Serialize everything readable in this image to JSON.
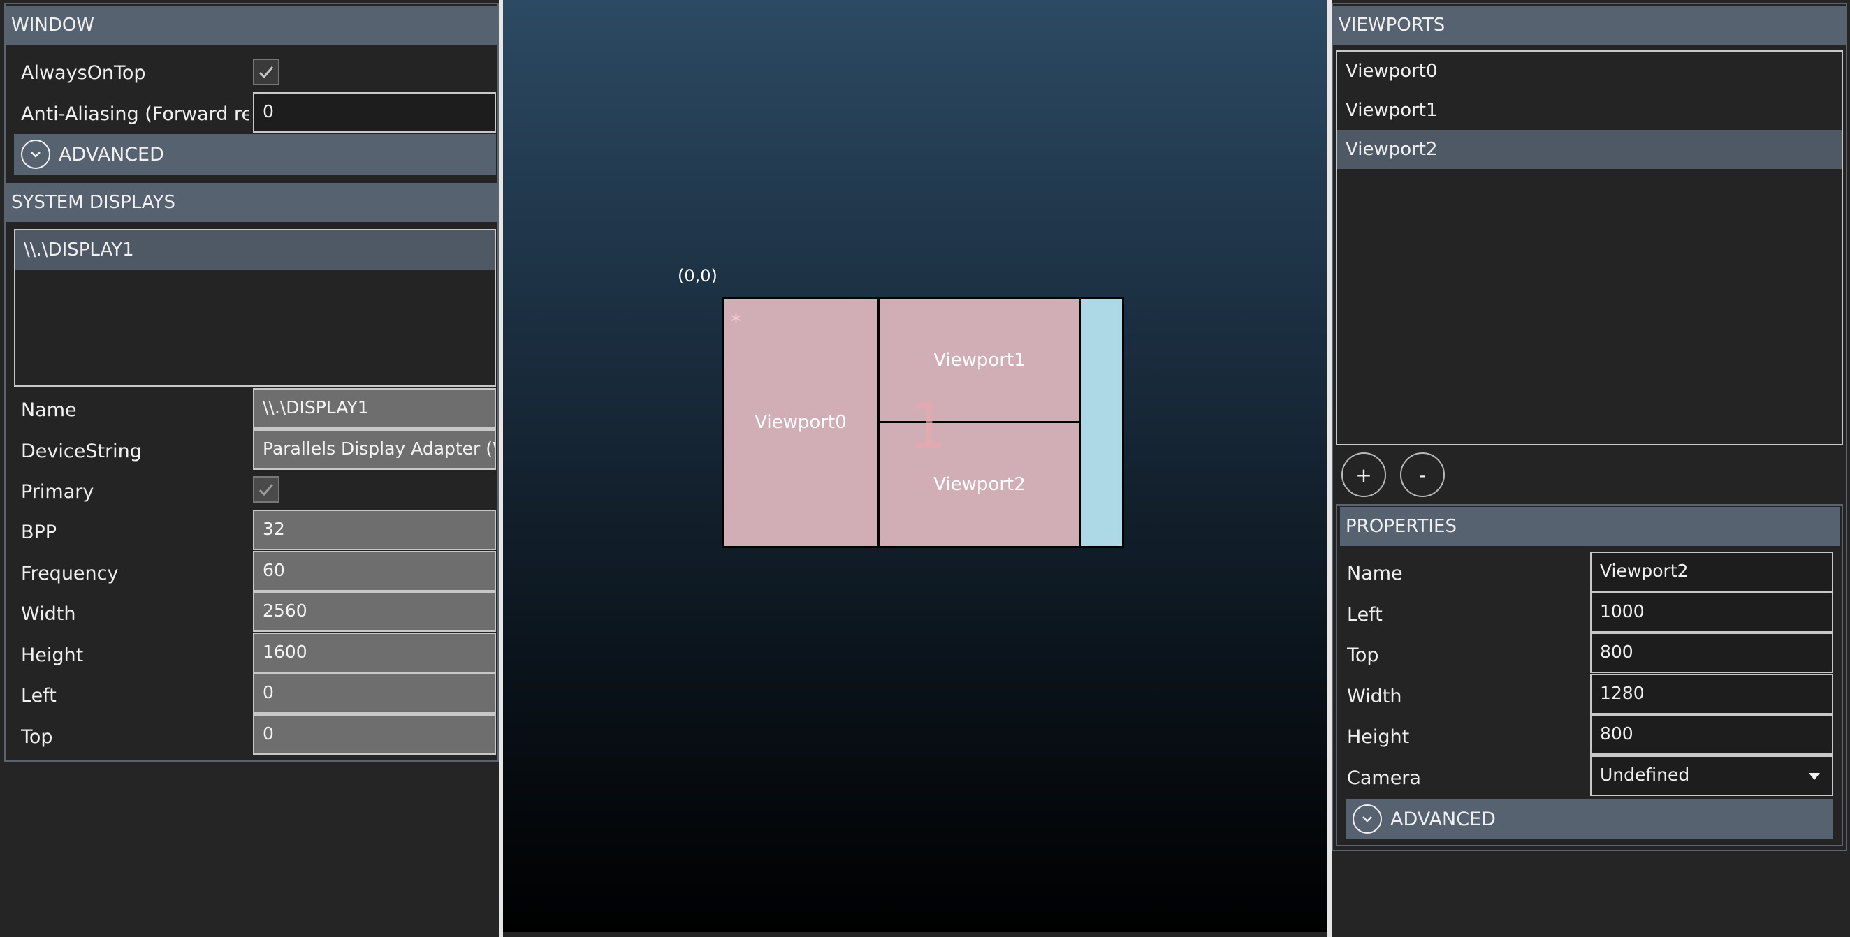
{
  "window": {
    "header": "WINDOW",
    "always_on_top_label": "AlwaysOnTop",
    "always_on_top_checked": true,
    "anti_aliasing_label": "Anti-Aliasing (Forward rend",
    "anti_aliasing_value": "0",
    "advanced_label": "ADVANCED"
  },
  "system_displays": {
    "header": "SYSTEM DISPLAYS",
    "list": [
      "\\\\.\\DISPLAY1"
    ],
    "props": [
      {
        "label": "Name",
        "value": "\\\\.\\DISPLAY1"
      },
      {
        "label": "DeviceString",
        "value": "Parallels Display Adapter (W"
      },
      {
        "label": "Primary",
        "value": ""
      },
      {
        "label": "BPP",
        "value": "32"
      },
      {
        "label": "Frequency",
        "value": "60"
      },
      {
        "label": "Width",
        "value": "2560"
      },
      {
        "label": "Height",
        "value": "1600"
      },
      {
        "label": "Left",
        "value": "0"
      },
      {
        "label": "Top",
        "value": "0"
      }
    ],
    "primary_checked": true
  },
  "canvas": {
    "origin_label": "(0,0)",
    "display_number": "1",
    "marker": "*",
    "viewports": [
      "Viewport0",
      "Viewport1",
      "Viewport2"
    ],
    "colors": {
      "viewport_fill": "#d1aeb6",
      "display_area": "#add8e6"
    }
  },
  "viewports": {
    "header": "VIEWPORTS",
    "list": [
      "Viewport0",
      "Viewport1",
      "Viewport2"
    ],
    "selected_index": 2,
    "add_label": "+",
    "remove_label": "-"
  },
  "properties": {
    "header": "PROPERTIES",
    "props": [
      {
        "label": "Name",
        "value": "Viewport2"
      },
      {
        "label": "Left",
        "value": "1000"
      },
      {
        "label": "Top",
        "value": "800"
      },
      {
        "label": "Width",
        "value": "1280"
      },
      {
        "label": "Height",
        "value": "800"
      },
      {
        "label": "Camera",
        "value": "Undefined"
      }
    ],
    "advanced_label": "ADVANCED"
  }
}
